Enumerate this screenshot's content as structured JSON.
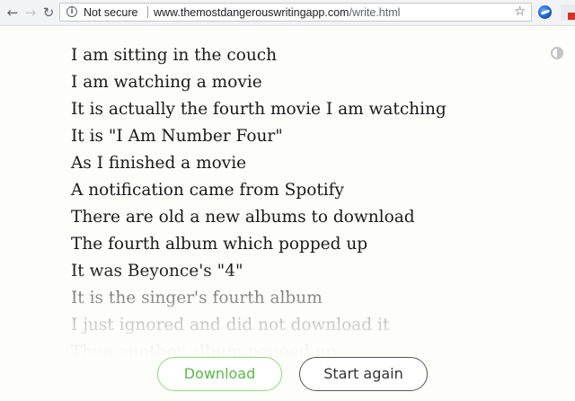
{
  "browser": {
    "back_glyph": "←",
    "forward_glyph": "→",
    "reload_glyph": "↻",
    "info_glyph": "i",
    "security_label": "Not secure",
    "url_host": "www.themostdangerouswritingapp.com",
    "url_path": "/write.html",
    "bookmark_glyph": "☆",
    "icons": [
      "back-arrow-icon",
      "forward-arrow-icon",
      "reload-icon",
      "info-icon",
      "star-icon",
      "extension-icon"
    ]
  },
  "editor": {
    "lines": [
      "I am sitting in the couch",
      "I am watching a movie",
      "It is actually the fourth movie I am watching",
      "It is \"I Am Number Four\"",
      "As I finished a movie",
      "A notification came from Spotify",
      "There are old a new albums to download",
      "The fourth album which popped up",
      "It was Beyonce's \"4\"",
      "It is the singer's fourth album",
      "I just ignored and did not download it",
      "Then another album popped up"
    ],
    "colors": {
      "text": "#1a1a1a",
      "background": "#fdfdfa"
    }
  },
  "actions": {
    "download_label": "Download",
    "start_again_label": "Start again",
    "download_color": "#5cb84a",
    "start_again_color": "#333333"
  }
}
